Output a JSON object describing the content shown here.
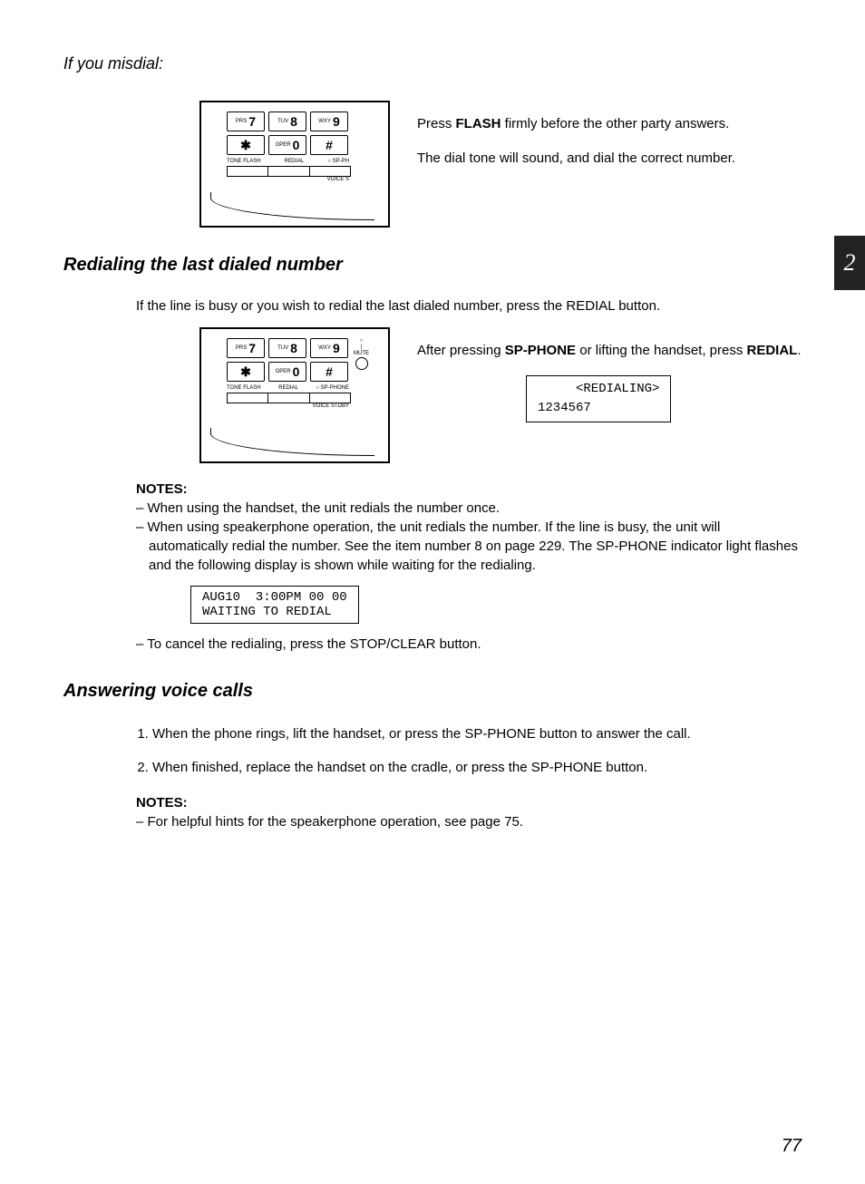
{
  "sideTab": "2",
  "pageNumber": "77",
  "misdial": {
    "heading": "If you misdial:",
    "keypad": {
      "r1": [
        [
          "PRS",
          "7"
        ],
        [
          "TUV",
          "8"
        ],
        [
          "WXY",
          "9"
        ]
      ],
      "r2": [
        [
          "",
          "✱"
        ],
        [
          "OPER",
          "0"
        ],
        [
          "",
          "#"
        ]
      ],
      "labels": [
        "TONE FLASH",
        "REDIAL",
        "○ SP-PH"
      ],
      "voice": "VOICE S"
    },
    "para1_pre": "Press ",
    "para1_bold": "FLASH",
    "para1_post": " firmly before the other party answers.",
    "para2": "The dial tone will sound, and dial the correct number."
  },
  "redial": {
    "heading": "Redialing the last dialed number",
    "intro": "If the line is busy or you wish to redial the last dialed number, press the REDIAL button.",
    "keypad": {
      "r1": [
        [
          "PRS",
          "7"
        ],
        [
          "TUV",
          "8"
        ],
        [
          "WXY",
          "9"
        ]
      ],
      "r2": [
        [
          "",
          "✱"
        ],
        [
          "OPER",
          "0"
        ],
        [
          "",
          "#"
        ]
      ],
      "mute": "MUTE",
      "labels": [
        "TONE FLASH",
        "REDIAL",
        "○ SP-PHONE"
      ],
      "voice": "VOICE STDBY"
    },
    "para_pre": "After pressing ",
    "para_b1": "SP-PHONE",
    "para_mid": " or lifting the handset, press ",
    "para_b2": "REDIAL",
    "para_post": ".",
    "lcd": "     <REDIALING>\n1234567",
    "notesHead": "NOTES:",
    "notes": [
      "When using the handset, the unit redials the number once.",
      "When using speakerphone operation, the unit redials the number. If the line is busy, the unit will automatically redial the number. See the item number 8 on page 229. The SP-PHONE indicator light flashes and the following display is shown while waiting for the redialing."
    ],
    "lcd2": "AUG10  3:00PM 00 00\nWAITING TO REDIAL",
    "note3": "To cancel the redialing, press the STOP/CLEAR button."
  },
  "answer": {
    "heading": "Answering voice calls",
    "steps": [
      "When the phone rings, lift the handset, or press the SP-PHONE button to answer the call.",
      "When finished, replace the handset on the cradle, or press the SP-PHONE button."
    ],
    "notesHead": "NOTES:",
    "notes": [
      "For helpful hints for the speakerphone operation, see page 75."
    ]
  }
}
